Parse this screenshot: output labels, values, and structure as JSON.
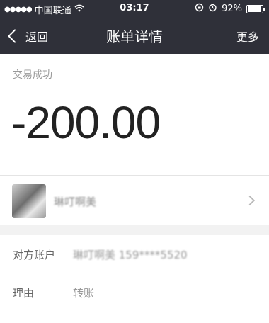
{
  "statusbar": {
    "carrier": "中国联通",
    "time": "03:17",
    "battery_percent": "92%",
    "battery_level": 0.92,
    "icons": [
      "signal-dots-icon",
      "wifi-icon",
      "rotation-lock-icon",
      "alarm-icon",
      "battery-icon"
    ]
  },
  "navbar": {
    "back_label": "返回",
    "title": "账单详情",
    "more_label": "更多"
  },
  "transaction": {
    "status": "交易成功",
    "amount": "-200.00"
  },
  "counterparty": {
    "name": "琳叮啊美"
  },
  "details": [
    {
      "label": "对方账户",
      "value": "琳叮啊美 159****5520"
    },
    {
      "label": "理由",
      "value": "转账"
    }
  ],
  "colors": {
    "navbar_bg": "#2f3039",
    "page_bg": "#ffffff",
    "section_gap": "#f2f2f2"
  }
}
